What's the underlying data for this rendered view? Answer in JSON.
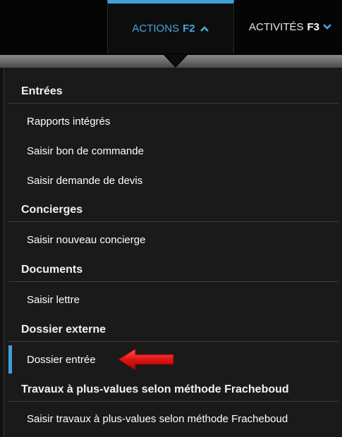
{
  "nav": {
    "actions_label": "ACTIONS",
    "actions_key": "F2",
    "activites_label": "ACTIVITÉS",
    "activites_key": "F3"
  },
  "menu": {
    "sections": [
      {
        "title": "Entrées",
        "items": [
          "Rapports intégrés",
          "Saisir bon de commande",
          "Saisir demande de devis"
        ]
      },
      {
        "title": "Concierges",
        "items": [
          "Saisir nouveau concierge"
        ]
      },
      {
        "title": "Documents",
        "items": [
          "Saisir lettre"
        ]
      },
      {
        "title": "Dossier externe",
        "items": [
          "Dossier entrée"
        ]
      },
      {
        "title": "Travaux à plus-values selon méthode Fracheboud",
        "items": [
          "Saisir travaux à plus-values selon méthode Fracheboud"
        ]
      }
    ],
    "highlighted_item": "Dossier entrée"
  },
  "colors": {
    "accent": "#3fa2d6",
    "menu_bg": "#1a1a1a",
    "annotation_arrow": "#e01414"
  }
}
